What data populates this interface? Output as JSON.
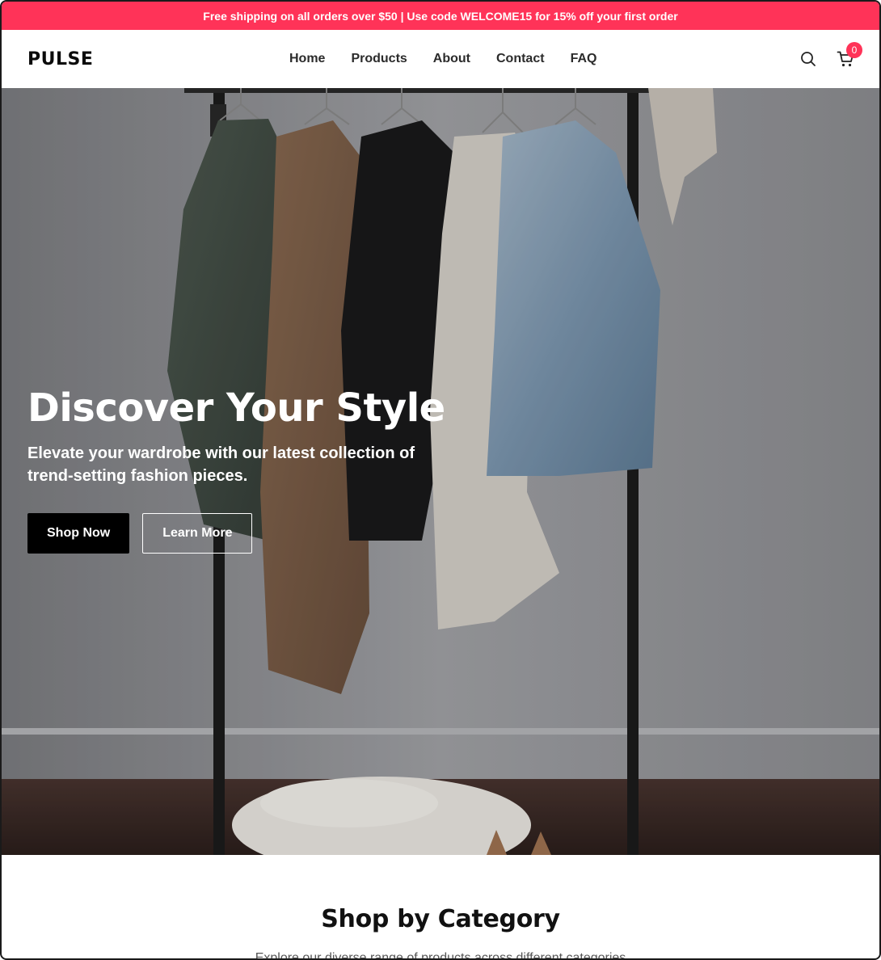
{
  "promo": {
    "text": "Free shipping on all orders over $50 | Use code WELCOME15 for 15% off your first order"
  },
  "header": {
    "logo": "PULSE",
    "nav": [
      {
        "label": "Home"
      },
      {
        "label": "Products"
      },
      {
        "label": "About"
      },
      {
        "label": "Contact"
      },
      {
        "label": "FAQ"
      }
    ],
    "search_icon": "search-icon",
    "cart_icon": "cart-icon",
    "cart_count": "0"
  },
  "hero": {
    "title": "Discover Your Style",
    "subtitle": "Elevate your wardrobe with our latest collection of trend-setting fashion pieces.",
    "primary_button": "Shop Now",
    "secondary_button": "Learn More"
  },
  "categories": {
    "title": "Shop by Category",
    "subtitle": "Explore our diverse range of products across different categories"
  },
  "colors": {
    "accent": "#ff3358",
    "primary_button": "#000000"
  }
}
